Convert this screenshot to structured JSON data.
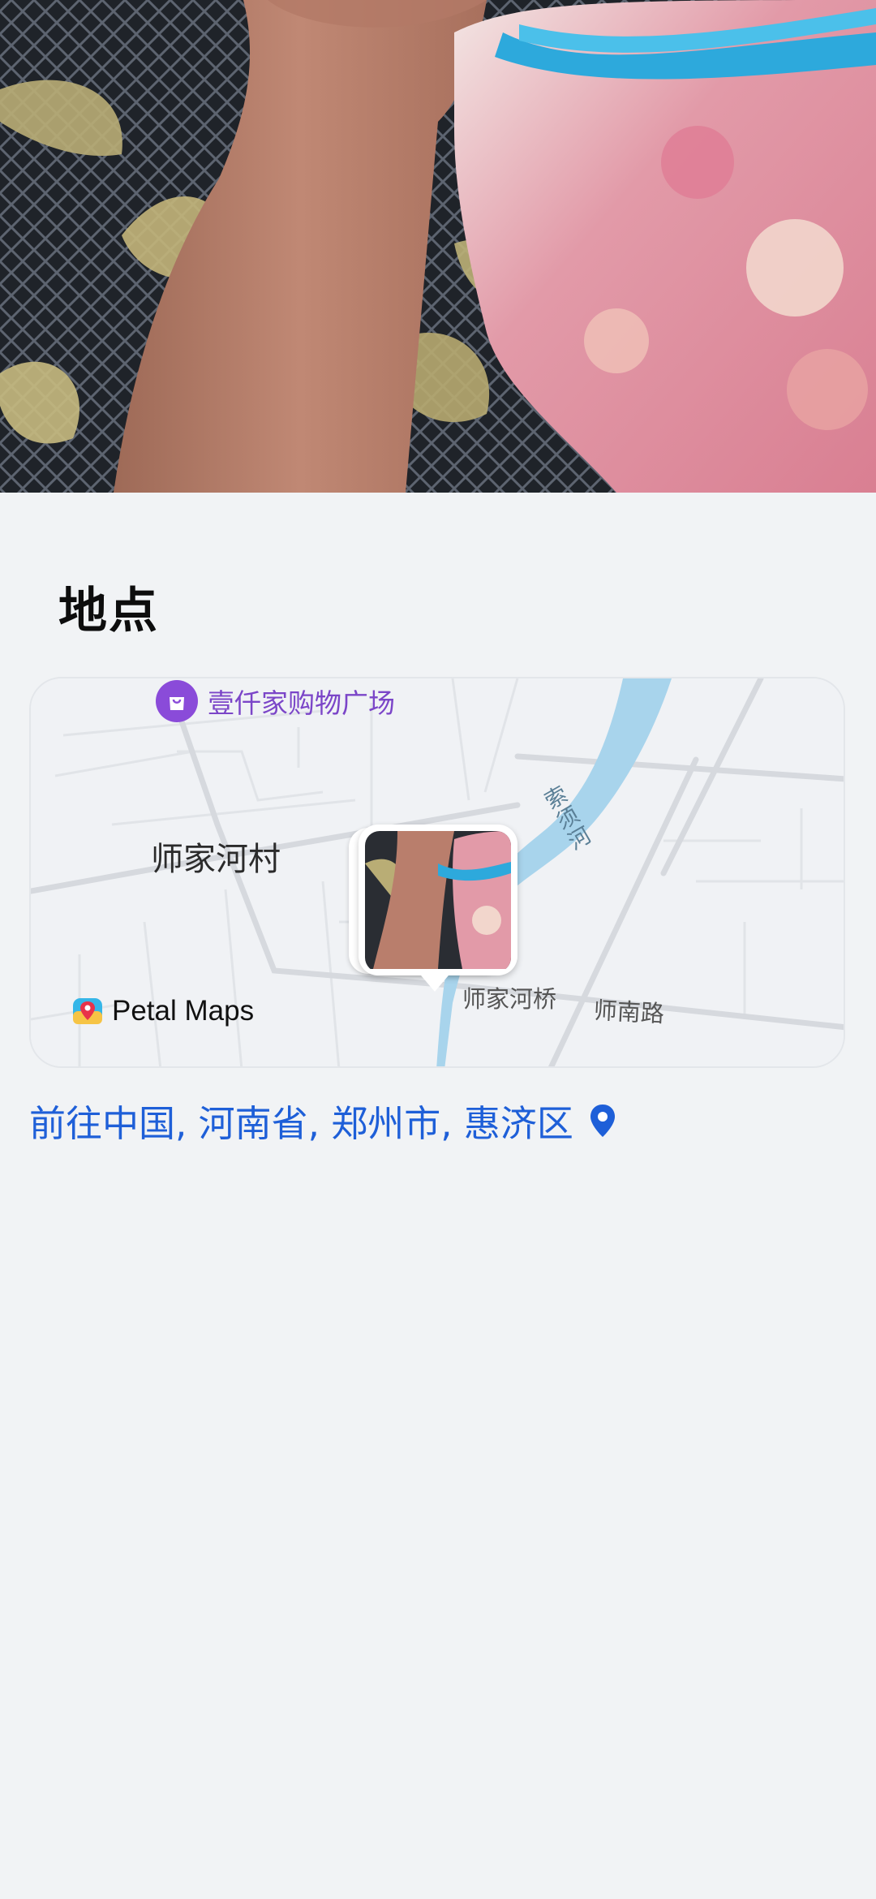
{
  "photo": {
    "description_icon": "photo-image"
  },
  "location_section": {
    "title": "地点"
  },
  "map": {
    "poi_label": "壹仟家购物广场",
    "poi_icon": "shopping-bag-icon",
    "village_label": "师家河村",
    "bridge_label": "师家河桥",
    "road_label": "师南路",
    "river_label": "索须河",
    "brand_label": "Petal Maps",
    "brand_icon": "petal-maps-icon",
    "colors": {
      "poi": "#8a4bd9",
      "river": "#a8d4ec",
      "road": "#d6d9de"
    }
  },
  "address": {
    "text": "前往中国, 河南省, 郑州市, 惠济区",
    "icon": "location-pin-icon",
    "color": "#1e5fd8"
  }
}
